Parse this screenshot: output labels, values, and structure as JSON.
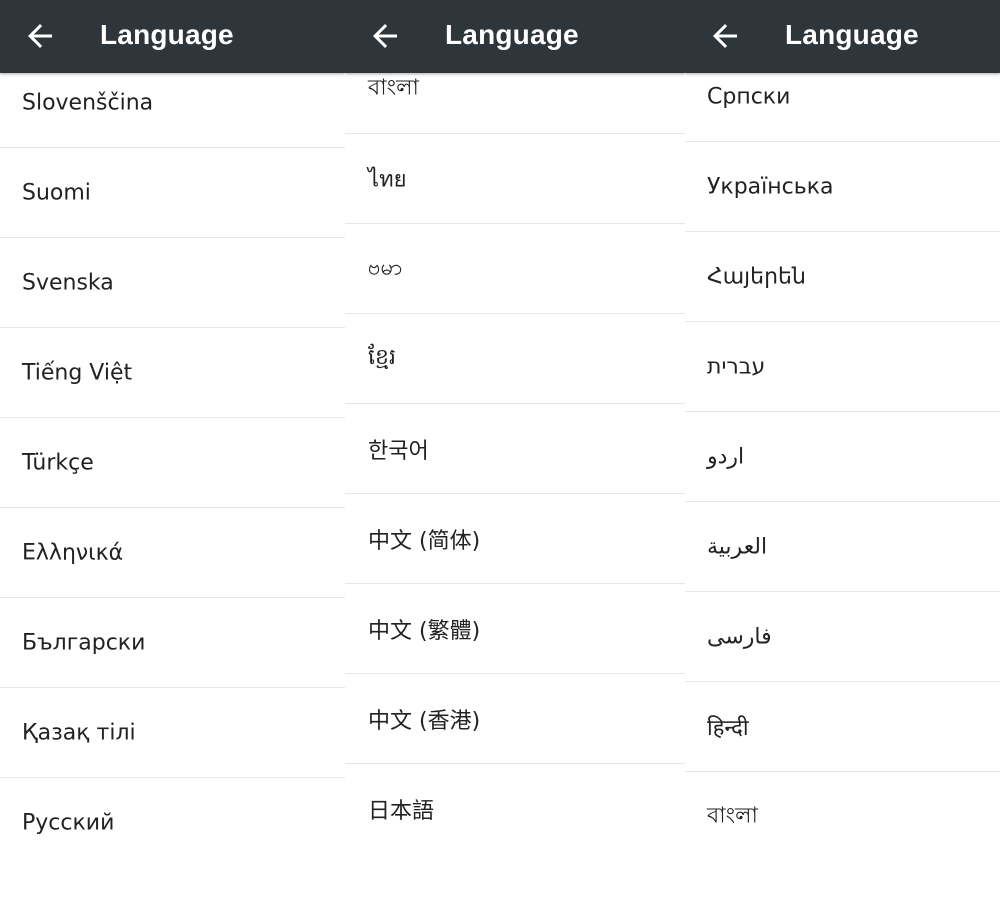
{
  "screens": [
    {
      "title": "Language",
      "items": [
        "Slovenščina",
        "Suomi",
        "Svenska",
        "Tiếng Việt",
        "Türkçe",
        "Ελληνικά",
        "Български",
        "Қазақ тілі",
        "Русский"
      ]
    },
    {
      "title": "Language",
      "items": [
        "বাংলা",
        "ไทย",
        "ဗမာ",
        "ខ្មែរ",
        "한국어",
        "中文 (简体)",
        "中文 (繁體)",
        "中文 (香港)",
        "日本語"
      ]
    },
    {
      "title": "Language",
      "items": [
        "Српски",
        "Українська",
        "Հայերեն",
        "עברית",
        "اردو",
        "العربية",
        "فارسی",
        "हिन्दी",
        "বাংলা"
      ]
    }
  ],
  "icons": {
    "back": "arrow-left-icon"
  },
  "colors": {
    "appbar": "#2e353b",
    "text": "#222222",
    "divider": "#e6e6e6"
  }
}
